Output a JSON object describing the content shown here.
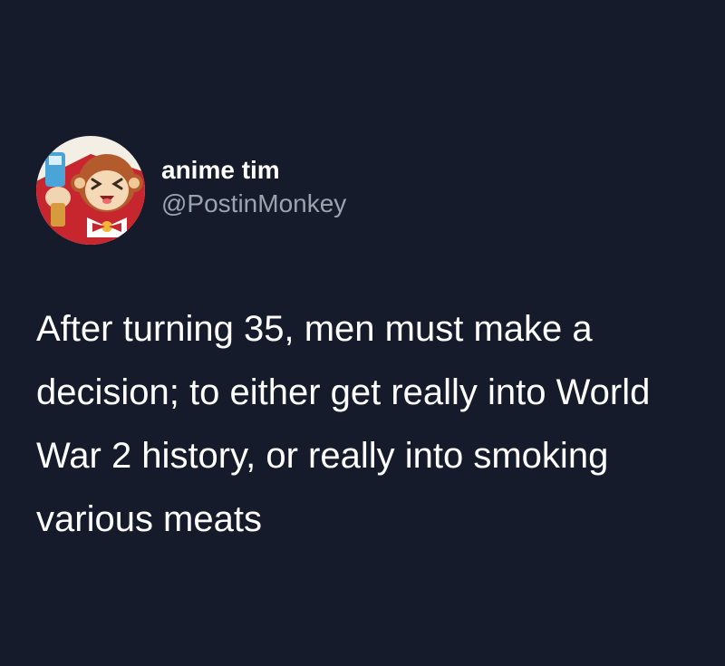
{
  "tweet": {
    "author": {
      "display_name": "anime tim",
      "handle": "@PostinMonkey",
      "avatar_icon": "monkey-character-avatar"
    },
    "text": "After turning 35, men must make a decision; to either get really into World War 2 history, or really into smoking various meats"
  },
  "colors": {
    "background": "#161b2b",
    "text_primary": "#ffffff",
    "text_secondary": "#9aa3b0"
  }
}
